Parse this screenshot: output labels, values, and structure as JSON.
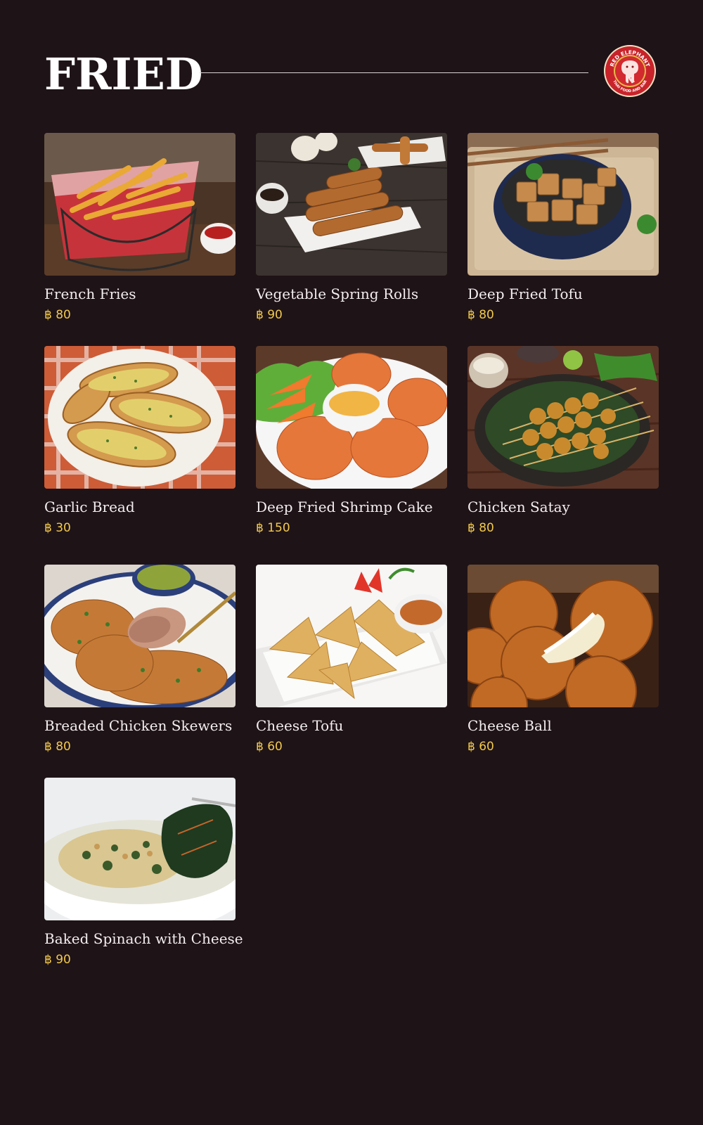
{
  "section": {
    "title": "FRIED"
  },
  "logo": {
    "text_top": "RED ELEPHANT",
    "text_bottom": "THAI FOOD AND BAR",
    "icon": "elephant-icon",
    "color": "#c8232a"
  },
  "colors": {
    "background": "#1e1317",
    "name": "#f3eef0",
    "price": "#f2c94c"
  },
  "items": [
    {
      "name": "French Fries",
      "price": "฿ 80",
      "image": "french-fries-photo"
    },
    {
      "name": "Vegetable Spring Rolls",
      "price": "฿ 90",
      "image": "spring-rolls-photo"
    },
    {
      "name": "Deep Fried Tofu",
      "price": "฿ 80",
      "image": "fried-tofu-photo"
    },
    {
      "name": "Garlic Bread",
      "price": "฿ 30",
      "image": "garlic-bread-photo"
    },
    {
      "name": "Deep Fried Shrimp Cake",
      "price": "฿ 150",
      "image": "shrimp-cake-photo"
    },
    {
      "name": "Chicken Satay",
      "price": "฿ 80",
      "image": "chicken-satay-photo"
    },
    {
      "name": "Breaded Chicken Skewers",
      "price": "฿ 80",
      "image": "breaded-chicken-photo"
    },
    {
      "name": "Cheese Tofu",
      "price": "฿ 60",
      "image": "cheese-tofu-photo"
    },
    {
      "name": "Cheese Ball",
      "price": "฿ 60",
      "image": "cheese-ball-photo"
    },
    {
      "name": "Baked Spinach with Cheese",
      "price": "฿ 90",
      "image": "baked-spinach-photo"
    }
  ]
}
